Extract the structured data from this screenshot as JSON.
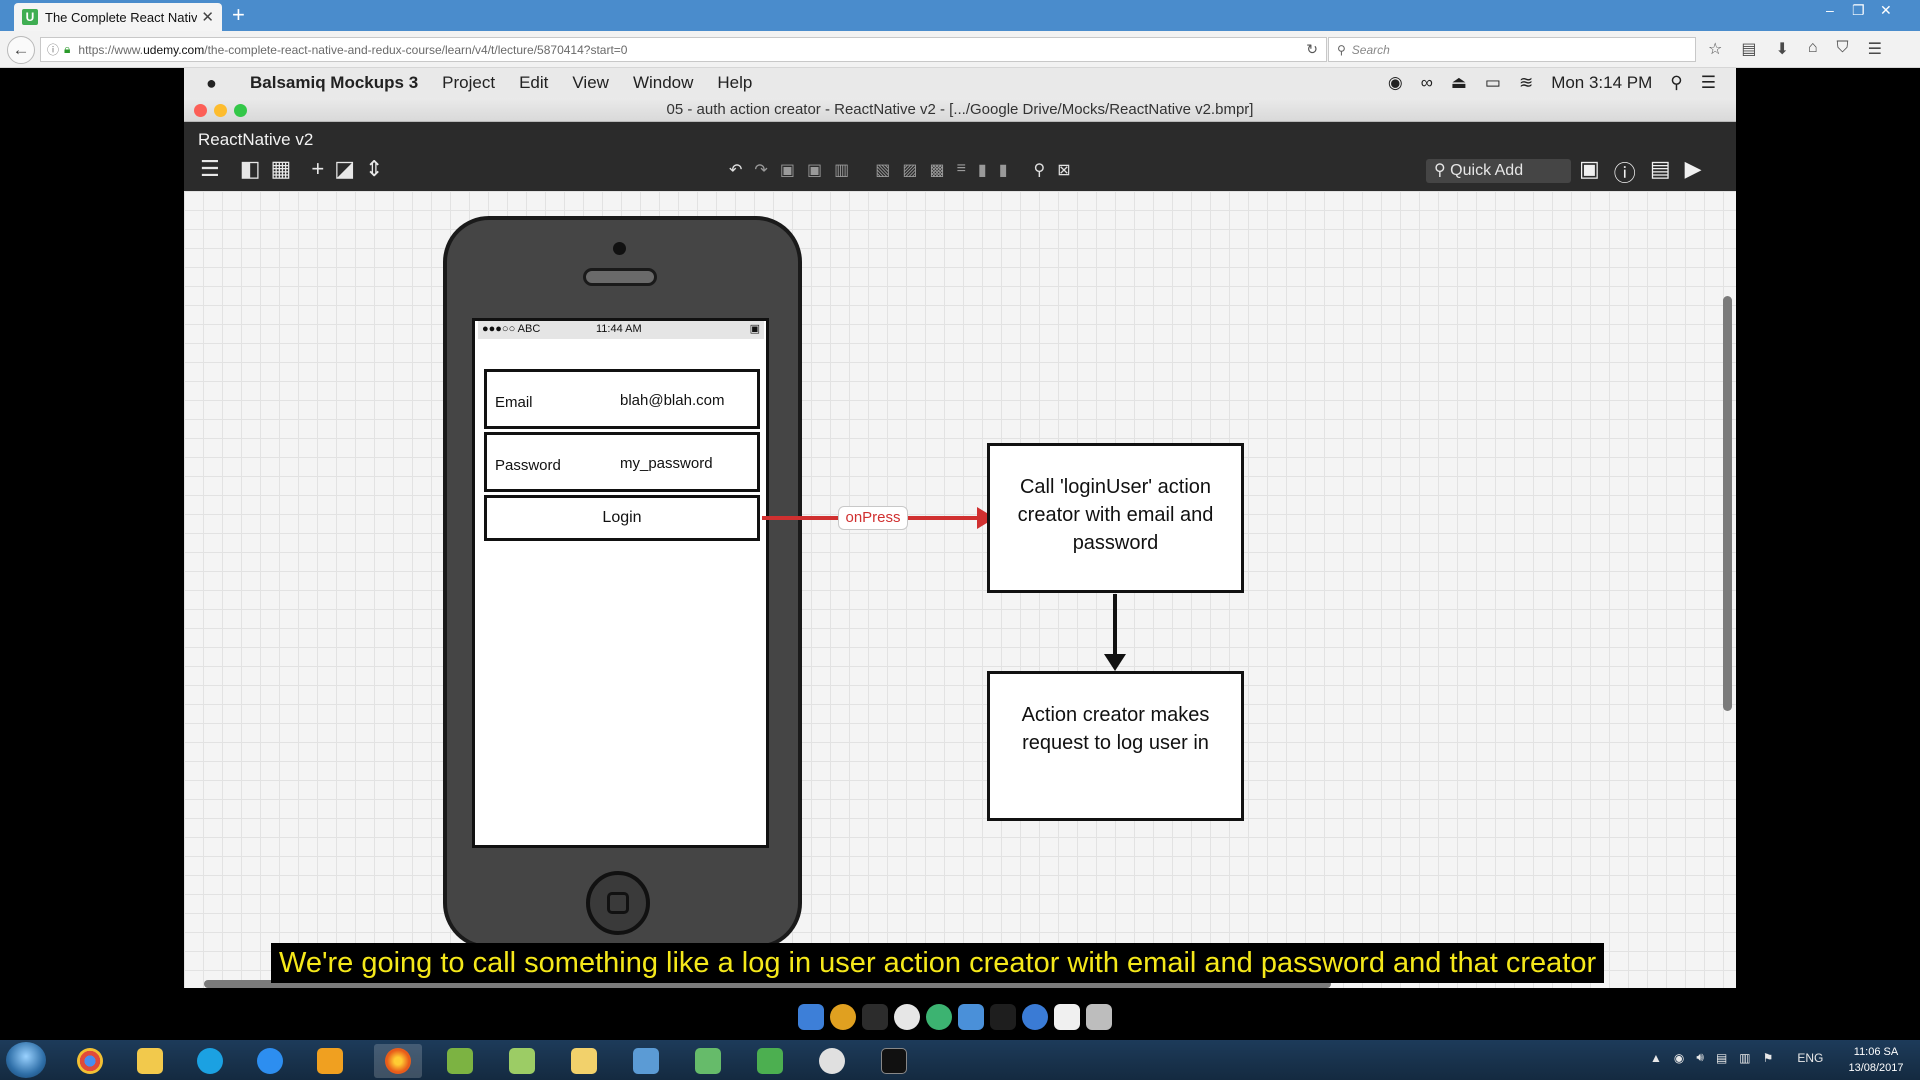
{
  "browser": {
    "tab_title": "The Complete React Native",
    "tab_favicon_letter": "U",
    "url_prefix": "https://www.",
    "url_domain": "udemy.com",
    "url_path": "/the-complete-react-native-and-redux-course/learn/v4/t/lecture/5870414?start=0",
    "search_placeholder": "Search"
  },
  "mac_menu": {
    "app_name": "Balsamiq Mockups 3",
    "items": [
      "Project",
      "Edit",
      "View",
      "Window",
      "Help"
    ],
    "clock": "Mon 3:14 PM"
  },
  "window": {
    "title": "05 - auth action creator - ReactNative v2 - [.../Google Drive/Mocks/ReactNative v2.bmpr]",
    "project_name": "ReactNative v2",
    "quick_add": "Quick Add"
  },
  "mockup": {
    "status_carrier": "●●●○○ ABC",
    "status_time": "11:44 AM",
    "email_label": "Email",
    "email_value": "blah@blah.com",
    "password_label": "Password",
    "password_value": "my_password",
    "login_button": "Login",
    "arrow_label": "onPress",
    "box1": "Call 'loginUser' action creator with email and password",
    "box2": "Action creator makes request to log user in"
  },
  "subtitle": "We're going to call something like a log in user action creator with email and password and that creator",
  "taskbar": {
    "lang": "ENG",
    "time": "11:06 SA",
    "date": "13/08/2017"
  },
  "colors": {
    "tabbar": "#4a8ccc",
    "arrow": "#d03030",
    "subtitle_text": "#f5e81a",
    "balsamiq_bar": "#2b2b2b"
  }
}
